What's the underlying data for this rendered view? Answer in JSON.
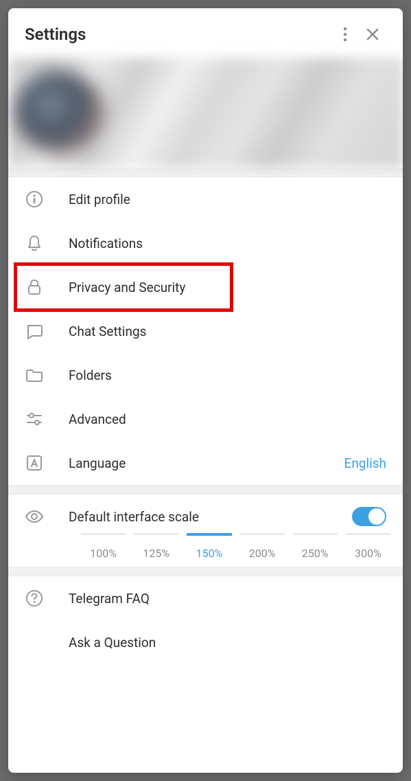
{
  "header": {
    "title": "Settings"
  },
  "menu": {
    "edit_profile": "Edit profile",
    "notifications": "Notifications",
    "privacy": "Privacy and Security",
    "chat_settings": "Chat Settings",
    "folders": "Folders",
    "advanced": "Advanced",
    "language": "Language",
    "language_value": "English"
  },
  "scale": {
    "label": "Default interface scale",
    "toggle_on": true,
    "options": [
      "100%",
      "125%",
      "150%",
      "200%",
      "250%",
      "300%"
    ],
    "selected": "150%"
  },
  "help": {
    "faq": "Telegram FAQ",
    "ask": "Ask a Question"
  },
  "highlight_target": "privacy-security-row"
}
